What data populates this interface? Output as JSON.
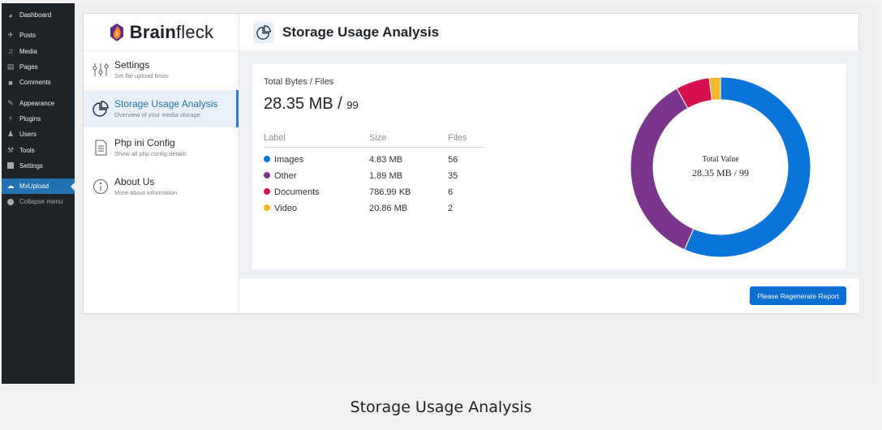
{
  "wp_menu": [
    {
      "name": "dashboard",
      "label": "Dashboard",
      "icon": "dashboard-icon"
    },
    {
      "name": "posts",
      "label": "Posts",
      "icon": "pin-icon"
    },
    {
      "name": "media",
      "label": "Media",
      "icon": "media-icon"
    },
    {
      "name": "pages",
      "label": "Pages",
      "icon": "pages-icon"
    },
    {
      "name": "comments",
      "label": "Comments",
      "icon": "comment-icon"
    },
    {
      "name": "appearance",
      "label": "Appearance",
      "icon": "brush-icon"
    },
    {
      "name": "plugins",
      "label": "Plugins",
      "icon": "plug-icon"
    },
    {
      "name": "users",
      "label": "Users",
      "icon": "user-icon"
    },
    {
      "name": "tools",
      "label": "Tools",
      "icon": "wrench-icon"
    },
    {
      "name": "settings",
      "label": "Settings",
      "icon": "settings-icon"
    },
    {
      "name": "mxupload",
      "label": "MxUpload",
      "icon": "cloud-icon"
    },
    {
      "name": "collapse",
      "label": "Collapse menu",
      "icon": "collapse-icon"
    }
  ],
  "logo": {
    "bold": "Brain",
    "light": "fleck"
  },
  "nav": [
    {
      "title": "Settings",
      "subtitle": "Set file upload limits",
      "icon": "sliders-icon"
    },
    {
      "title": "Storage Usage Analysis",
      "subtitle": "Overview of your media storage",
      "icon": "pie-chart-icon"
    },
    {
      "title": "Php ini Config",
      "subtitle": "Show all php config details",
      "icon": "document-icon"
    },
    {
      "title": "About Us",
      "subtitle": "More about information",
      "icon": "info-icon"
    }
  ],
  "page": {
    "title": "Storage Usage Analysis",
    "icon": "pie-chart-icon"
  },
  "summary": {
    "label": "Total Bytes / Files",
    "size": "28.35 MB",
    "separator": " / ",
    "files": "99"
  },
  "table": {
    "headers": [
      "Label",
      "Size",
      "Files"
    ],
    "rows": [
      {
        "label": "Images",
        "size": "4.83 MB",
        "files": "56",
        "color": "#0b74d9"
      },
      {
        "label": "Other",
        "size": "1.89 MB",
        "files": "35",
        "color": "#7b368c"
      },
      {
        "label": "Documents",
        "size": "786.99 KB",
        "files": "6",
        "color": "#d6104e"
      },
      {
        "label": "Video",
        "size": "20.86 MB",
        "files": "2",
        "color": "#f6b52b"
      }
    ]
  },
  "chart_data": {
    "type": "pie",
    "donut": true,
    "categories": [
      "Images",
      "Other",
      "Documents",
      "Video"
    ],
    "values": [
      56,
      35,
      6,
      2
    ],
    "colors": [
      "#0b74d9",
      "#7b368c",
      "#d6104e",
      "#f6b52b"
    ],
    "center_label": "Total Value",
    "center_value": "28.35 MB / 99"
  },
  "footer": {
    "regenerate_label": "Please Regenerate Report"
  },
  "caption": "Storage Usage Analysis"
}
